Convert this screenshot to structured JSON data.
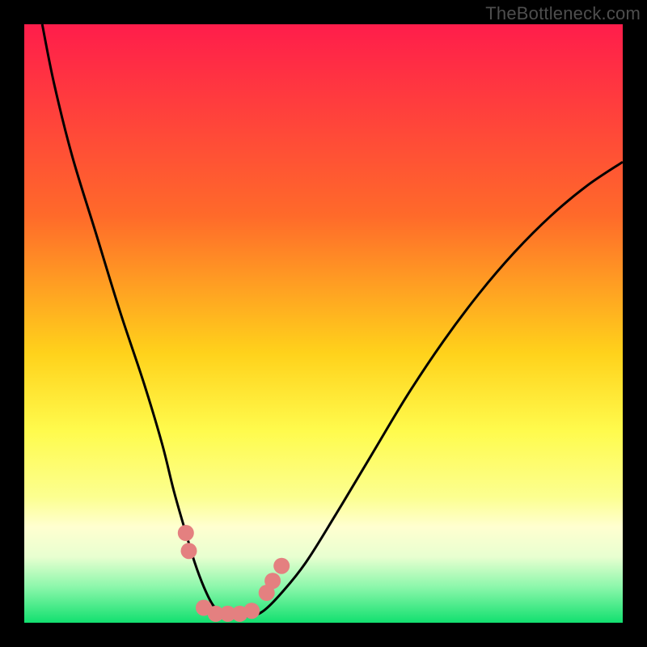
{
  "watermark": "TheBottleneck.com",
  "chart_data": {
    "type": "line",
    "title": "",
    "xlabel": "",
    "ylabel": "",
    "xlim": [
      0,
      100
    ],
    "ylim": [
      0,
      100
    ],
    "gradient_stops": [
      {
        "offset": 0,
        "color": "#ff1d4b"
      },
      {
        "offset": 0.32,
        "color": "#ff6a2a"
      },
      {
        "offset": 0.55,
        "color": "#ffd21b"
      },
      {
        "offset": 0.68,
        "color": "#fffb4d"
      },
      {
        "offset": 0.79,
        "color": "#fcff90"
      },
      {
        "offset": 0.84,
        "color": "#ffffd0"
      },
      {
        "offset": 0.89,
        "color": "#e8ffd0"
      },
      {
        "offset": 0.94,
        "color": "#8cf7ab"
      },
      {
        "offset": 1.0,
        "color": "#12e06f"
      }
    ],
    "series": [
      {
        "name": "bottleneck-curve",
        "x": [
          3,
          5,
          8,
          12,
          16,
          20,
          23,
          25,
          27,
          28.5,
          30,
          31.5,
          33,
          34.5,
          36,
          38,
          40,
          43,
          47,
          52,
          58,
          64,
          70,
          76,
          82,
          88,
          94,
          100
        ],
        "y": [
          100,
          90,
          78,
          65,
          52,
          40,
          30,
          22,
          15,
          10,
          6,
          3,
          1.5,
          1,
          1,
          1.2,
          2,
          5,
          10,
          18,
          28,
          38,
          47,
          55,
          62,
          68,
          73,
          77
        ]
      }
    ],
    "markers": [
      {
        "x": 27.0,
        "y": 15.0
      },
      {
        "x": 27.5,
        "y": 12.0
      },
      {
        "x": 30.0,
        "y": 2.5
      },
      {
        "x": 32.0,
        "y": 1.5
      },
      {
        "x": 34.0,
        "y": 1.5
      },
      {
        "x": 36.0,
        "y": 1.5
      },
      {
        "x": 38.0,
        "y": 2.0
      },
      {
        "x": 40.5,
        "y": 5.0
      },
      {
        "x": 41.5,
        "y": 7.0
      },
      {
        "x": 43.0,
        "y": 9.5
      }
    ],
    "marker_style": {
      "color": "#e48080",
      "radius_px": 10
    }
  }
}
